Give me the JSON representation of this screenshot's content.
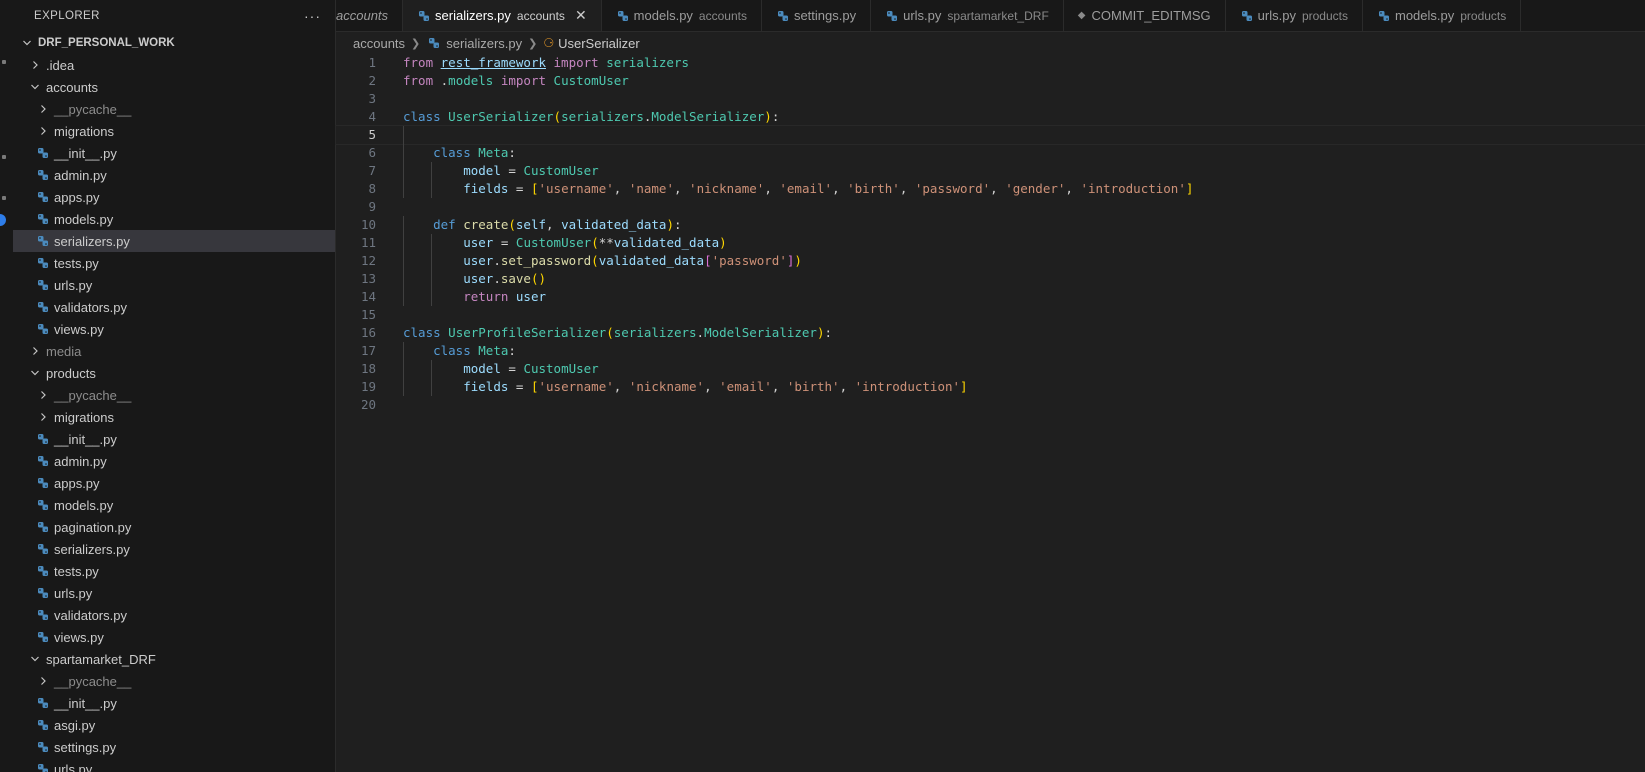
{
  "explorer": {
    "title": "EXPLORER",
    "root": "DRF_PERSONAL_WORK",
    "items": [
      {
        "label": ".idea",
        "kind": "folder",
        "depth": 1,
        "open": false
      },
      {
        "label": "accounts",
        "kind": "folder",
        "depth": 1,
        "open": true
      },
      {
        "label": "__pycache__",
        "kind": "folder",
        "depth": 2,
        "open": false,
        "dim": true
      },
      {
        "label": "migrations",
        "kind": "folder",
        "depth": 2,
        "open": false
      },
      {
        "label": "__init__.py",
        "kind": "py",
        "depth": 2
      },
      {
        "label": "admin.py",
        "kind": "py",
        "depth": 2
      },
      {
        "label": "apps.py",
        "kind": "py",
        "depth": 2
      },
      {
        "label": "models.py",
        "kind": "py",
        "depth": 2
      },
      {
        "label": "serializers.py",
        "kind": "py",
        "depth": 2,
        "selected": true
      },
      {
        "label": "tests.py",
        "kind": "py",
        "depth": 2
      },
      {
        "label": "urls.py",
        "kind": "py",
        "depth": 2
      },
      {
        "label": "validators.py",
        "kind": "py",
        "depth": 2
      },
      {
        "label": "views.py",
        "kind": "py",
        "depth": 2
      },
      {
        "label": "media",
        "kind": "folder",
        "depth": 1,
        "open": false,
        "dim": true
      },
      {
        "label": "products",
        "kind": "folder",
        "depth": 1,
        "open": true
      },
      {
        "label": "__pycache__",
        "kind": "folder",
        "depth": 2,
        "open": false,
        "dim": true
      },
      {
        "label": "migrations",
        "kind": "folder",
        "depth": 2,
        "open": false
      },
      {
        "label": "__init__.py",
        "kind": "py",
        "depth": 2
      },
      {
        "label": "admin.py",
        "kind": "py",
        "depth": 2
      },
      {
        "label": "apps.py",
        "kind": "py",
        "depth": 2
      },
      {
        "label": "models.py",
        "kind": "py",
        "depth": 2
      },
      {
        "label": "pagination.py",
        "kind": "py",
        "depth": 2
      },
      {
        "label": "serializers.py",
        "kind": "py",
        "depth": 2
      },
      {
        "label": "tests.py",
        "kind": "py",
        "depth": 2
      },
      {
        "label": "urls.py",
        "kind": "py",
        "depth": 2
      },
      {
        "label": "validators.py",
        "kind": "py",
        "depth": 2
      },
      {
        "label": "views.py",
        "kind": "py",
        "depth": 2
      },
      {
        "label": "spartamarket_DRF",
        "kind": "folder",
        "depth": 1,
        "open": true
      },
      {
        "label": "__pycache__",
        "kind": "folder",
        "depth": 2,
        "open": false,
        "dim": true
      },
      {
        "label": "__init__.py",
        "kind": "py",
        "depth": 2
      },
      {
        "label": "asgi.py",
        "kind": "py",
        "depth": 2
      },
      {
        "label": "settings.py",
        "kind": "py",
        "depth": 2
      },
      {
        "label": "urls.py",
        "kind": "py",
        "depth": 2
      }
    ]
  },
  "tabs": [
    {
      "name": "accounts",
      "desc": "",
      "italic": true,
      "icon": "none"
    },
    {
      "name": "serializers.py",
      "desc": "accounts",
      "active": true,
      "icon": "python-icon"
    },
    {
      "name": "models.py",
      "desc": "accounts",
      "icon": "python-icon"
    },
    {
      "name": "settings.py",
      "desc": "",
      "icon": "python-icon"
    },
    {
      "name": "urls.py",
      "desc": "spartamarket_DRF",
      "icon": "python-icon"
    },
    {
      "name": "COMMIT_EDITMSG",
      "desc": "",
      "icon": "git-icon"
    },
    {
      "name": "urls.py",
      "desc": "products",
      "icon": "python-icon"
    },
    {
      "name": "models.py",
      "desc": "products",
      "icon": "python-icon"
    }
  ],
  "breadcrumb": {
    "folder": "accounts",
    "file": "serializers.py",
    "symbol": "UserSerializer"
  },
  "editor": {
    "current_line": 5,
    "lines": [
      "from rest_framework import serializers",
      "from .models import CustomUser",
      "",
      "class UserSerializer(serializers.ModelSerializer):",
      "",
      "    class Meta:",
      "        model = CustomUser",
      "        fields = ['username', 'name', 'nickname', 'email', 'birth', 'password', 'gender', 'introduction']",
      "",
      "    def create(self, validated_data):",
      "        user = CustomUser(**validated_data)",
      "        user.set_password(validated_data['password'])",
      "        user.save()",
      "        return user",
      "",
      "class UserProfileSerializer(serializers.ModelSerializer):",
      "    class Meta:",
      "        model = CustomUser",
      "        fields = ['username', 'nickname', 'email', 'birth', 'introduction']",
      ""
    ]
  },
  "colors": {
    "background": "#1f1f1f",
    "sidebar": "#181818",
    "selection": "#37373d",
    "accent": "#2e7de9"
  }
}
